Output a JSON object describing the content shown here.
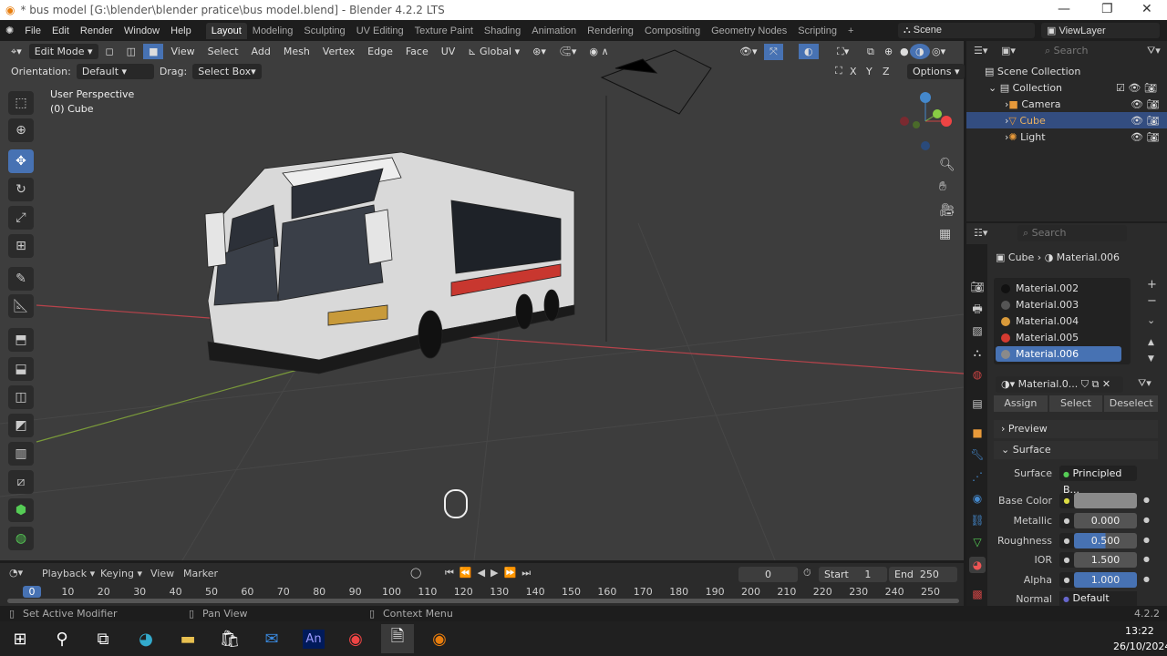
{
  "window": {
    "title": "* bus model [G:\\blender\\blender pratice\\bus model.blend] - Blender 4.2.2 LTS"
  },
  "menu": [
    "File",
    "Edit",
    "Render",
    "Window",
    "Help"
  ],
  "workspaces": [
    "Layout",
    "Modeling",
    "Sculpting",
    "UV Editing",
    "Texture Paint",
    "Shading",
    "Animation",
    "Rendering",
    "Compositing",
    "Geometry Nodes",
    "Scripting"
  ],
  "scene": "Scene",
  "view_layer": "ViewLayer",
  "viewport": {
    "mode": "Edit Mode",
    "menus": [
      "View",
      "Select",
      "Add",
      "Mesh",
      "Vertex",
      "Edge",
      "Face",
      "UV"
    ],
    "transform": "Global",
    "orientation_label": "Orientation:",
    "orientation": "Default",
    "drag_label": "Drag:",
    "drag": "Select Box",
    "axes": [
      "X",
      "Y",
      "Z"
    ],
    "options": "Options",
    "view_name": "User Perspective",
    "object": "(0) Cube"
  },
  "outliner": {
    "search": "Search",
    "items": [
      {
        "label": "Scene Collection"
      },
      {
        "label": "Collection"
      },
      {
        "label": "Camera"
      },
      {
        "label": "Cube",
        "selected": true
      },
      {
        "label": "Light"
      }
    ]
  },
  "properties": {
    "search": "Search",
    "breadcrumb": [
      "Cube",
      "Material.006"
    ],
    "materials": [
      {
        "name": "Material.002",
        "color": "#111111"
      },
      {
        "name": "Material.003",
        "color": "#555555"
      },
      {
        "name": "Material.004",
        "color": "#d99a3a"
      },
      {
        "name": "Material.005",
        "color": "#d43a30"
      },
      {
        "name": "Material.006",
        "color": "#8a8a8a",
        "selected": true
      }
    ],
    "slot_name": "Material.0...",
    "buttons": [
      "Assign",
      "Select",
      "Deselect"
    ],
    "preview": "Preview",
    "surface_panel": "Surface",
    "fields": [
      {
        "label": "Surface",
        "value": "Principled B..."
      },
      {
        "label": "Base Color",
        "value": ""
      },
      {
        "label": "Metallic",
        "value": "0.000"
      },
      {
        "label": "Roughness",
        "value": "0.500",
        "fill": 0.5
      },
      {
        "label": "IOR",
        "value": "1.500"
      },
      {
        "label": "Alpha",
        "value": "1.000",
        "fill": 1.0
      },
      {
        "label": "Normal",
        "value": "Default"
      }
    ]
  },
  "timeline": {
    "menus": [
      "Playback",
      "Keying",
      "View",
      "Marker"
    ],
    "current_frame": "0",
    "start_label": "Start",
    "start": "1",
    "end_label": "End",
    "end": "250",
    "ticks": [
      "0",
      "10",
      "20",
      "30",
      "40",
      "50",
      "60",
      "70",
      "80",
      "90",
      "100",
      "110",
      "120",
      "130",
      "140",
      "150",
      "160",
      "170",
      "180",
      "190",
      "200",
      "210",
      "220",
      "230",
      "240",
      "250"
    ]
  },
  "status": {
    "left": "Set Active Modifier",
    "mid": "Pan View",
    "right": "Context Menu",
    "version": "4.2.2"
  },
  "taskbar": {
    "time": "13:22",
    "date": "26/10/2024",
    "an": "An"
  },
  "colors": {
    "accent": "#4772b3",
    "viewport": "#3d3d3d",
    "x_axis": "#b8434b",
    "y_axis": "#7a9a3a"
  }
}
